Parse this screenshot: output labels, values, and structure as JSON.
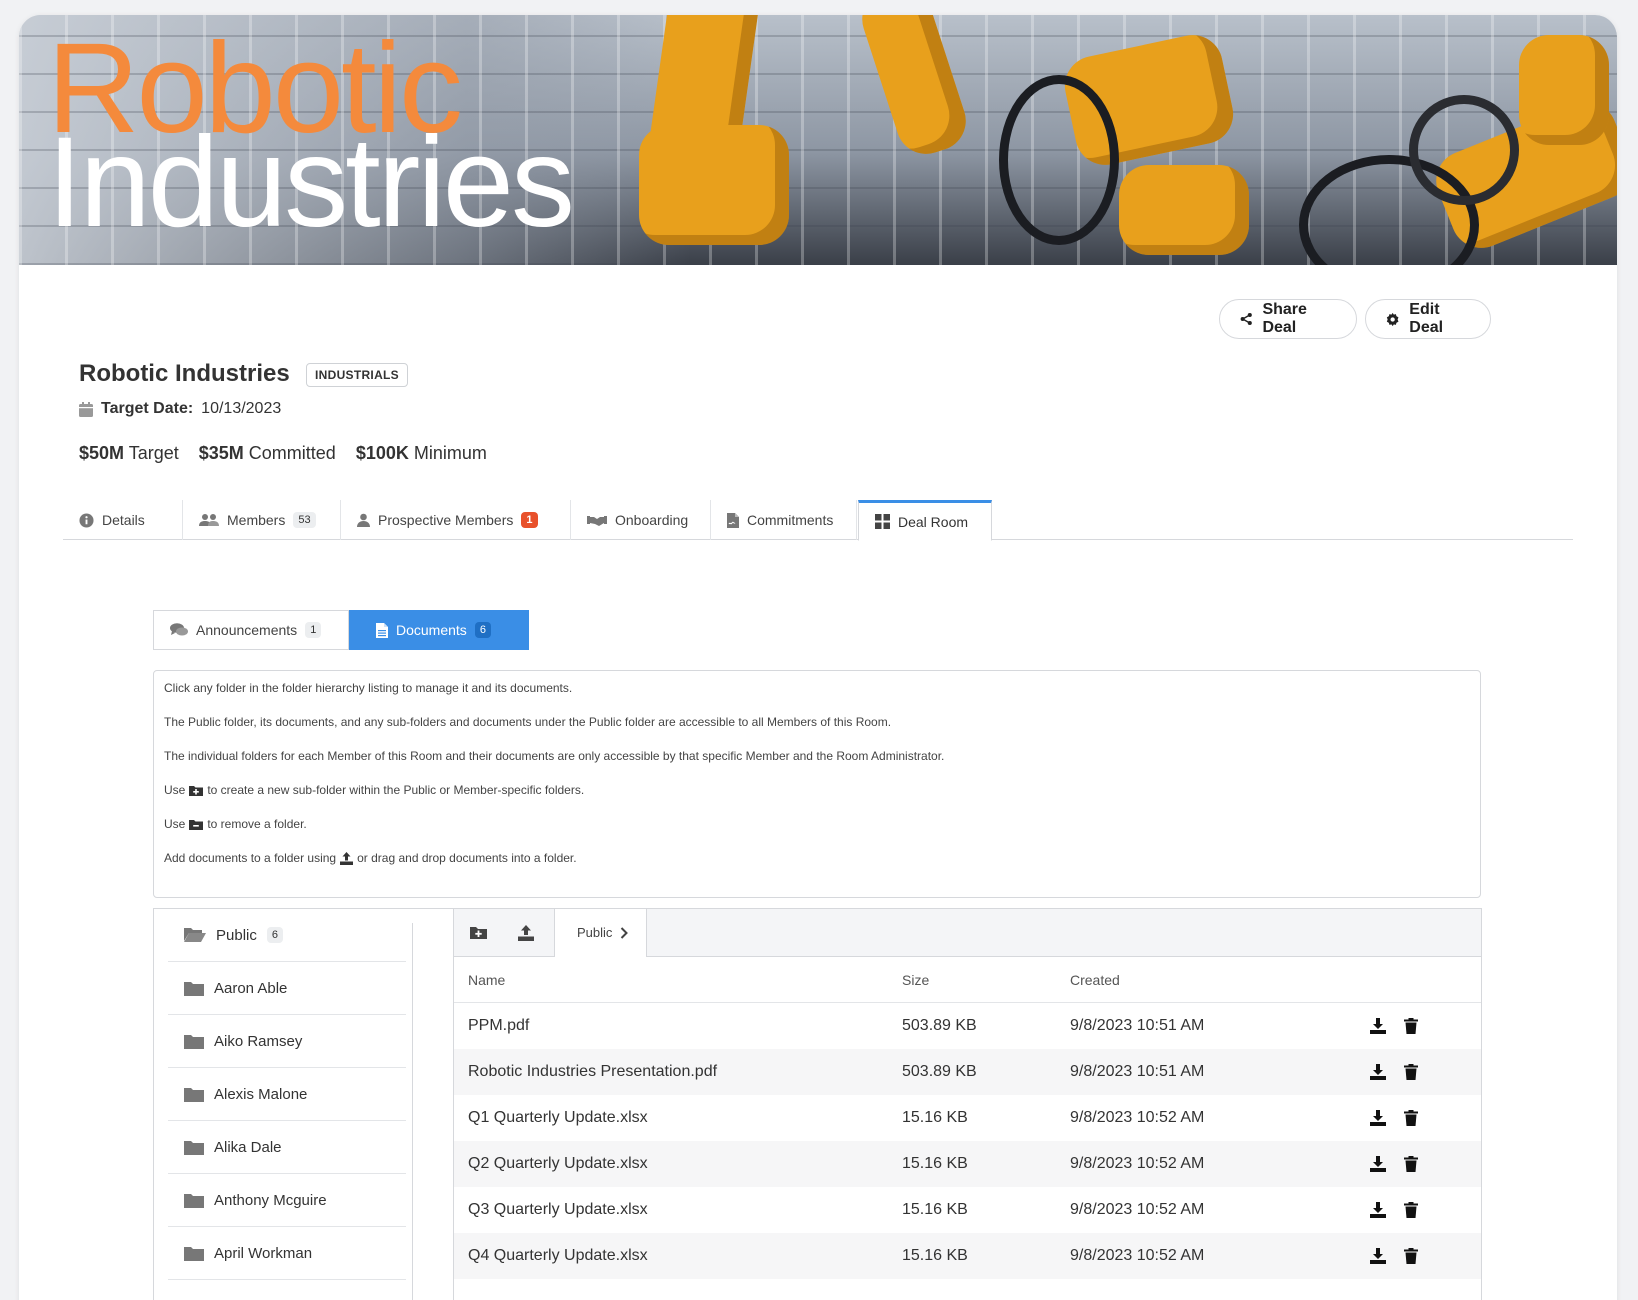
{
  "banner": {
    "line1": "Robotic",
    "line2": "Industries"
  },
  "actions": {
    "share": "Share Deal",
    "edit": "Edit Deal"
  },
  "deal": {
    "name": "Robotic Industries",
    "sector": "INDUSTRIALS",
    "target_date_label": "Target Date:",
    "target_date": "10/13/2023",
    "stats": [
      {
        "value": "$50M",
        "label": "Target"
      },
      {
        "value": "$35M",
        "label": "Committed"
      },
      {
        "value": "$100K",
        "label": "Minimum"
      }
    ]
  },
  "tabs": [
    {
      "label": "Details",
      "icon": "info-icon"
    },
    {
      "label": "Members",
      "count": "53",
      "icon": "users-icon"
    },
    {
      "label": "Prospective Members",
      "count": "1",
      "icon": "user-icon"
    },
    {
      "label": "Onboarding",
      "icon": "handshake-icon"
    },
    {
      "label": "Commitments",
      "icon": "file-signature-icon"
    },
    {
      "label": "Deal Room",
      "icon": "grid-icon",
      "active": true
    }
  ],
  "subtabs": [
    {
      "label": "Announcements",
      "count": "1",
      "icon": "comments-icon"
    },
    {
      "label": "Documents",
      "count": "6",
      "icon": "file-icon",
      "active": true
    }
  ],
  "info": {
    "line1": "Click any folder in the folder hierarchy listing to manage it and its documents.",
    "line2": "The Public folder, its documents, and any sub-folders and documents under the Public folder are accessible to all Members of this Room.",
    "line3": "The individual folders for each Member of this Room and their documents are only accessible by that specific Member and the Room Administrator.",
    "line4_pre": "Use",
    "line4_post": "to create a new sub-folder within the Public or Member-specific folders.",
    "line5_pre": "Use",
    "line5_post": "to remove a folder.",
    "line6_pre": "Add documents to a folder using",
    "line6_post": "or drag and drop documents into a folder."
  },
  "folders": [
    {
      "name": "Public",
      "count": "6",
      "open": true
    },
    {
      "name": "Aaron Able"
    },
    {
      "name": "Aiko Ramsey"
    },
    {
      "name": "Alexis Malone"
    },
    {
      "name": "Alika Dale"
    },
    {
      "name": "Anthony Mcguire"
    },
    {
      "name": "April Workman"
    }
  ],
  "breadcrumb": "Public",
  "table": {
    "headers": {
      "name": "Name",
      "size": "Size",
      "created": "Created"
    },
    "rows": [
      {
        "name": "PPM.pdf",
        "size": "503.89 KB",
        "created": "9/8/2023 10:51 AM"
      },
      {
        "name": "Robotic Industries Presentation.pdf",
        "size": "503.89 KB",
        "created": "9/8/2023 10:51 AM"
      },
      {
        "name": "Q1 Quarterly Update.xlsx",
        "size": "15.16 KB",
        "created": "9/8/2023 10:52 AM"
      },
      {
        "name": "Q2 Quarterly Update.xlsx",
        "size": "15.16 KB",
        "created": "9/8/2023 10:52 AM"
      },
      {
        "name": "Q3 Quarterly Update.xlsx",
        "size": "15.16 KB",
        "created": "9/8/2023 10:52 AM"
      },
      {
        "name": "Q4 Quarterly Update.xlsx",
        "size": "15.16 KB",
        "created": "9/8/2023 10:52 AM"
      }
    ]
  },
  "colors": {
    "accent": "#3a8ee6",
    "orange": "#f48a3c",
    "red_badge": "#e8512b"
  }
}
